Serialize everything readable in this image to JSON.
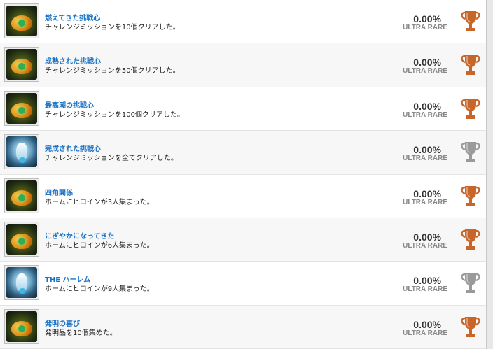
{
  "trophies": [
    {
      "title": "燃えてきた挑戦心",
      "description": "チャレンジミッションを10個クリアした。",
      "percent": "0.00%",
      "rarity": "ULTRA RARE",
      "tier": "bronze",
      "icon": "gold-emblem-icon"
    },
    {
      "title": "成熟された挑戦心",
      "description": "チャレンジミッションを50個クリアした。",
      "percent": "0.00%",
      "rarity": "ULTRA RARE",
      "tier": "bronze",
      "icon": "gold-emblem-icon"
    },
    {
      "title": "最高潮の挑戦心",
      "description": "チャレンジミッションを100個クリアした。",
      "percent": "0.00%",
      "rarity": "ULTRA RARE",
      "tier": "bronze",
      "icon": "gold-emblem-icon"
    },
    {
      "title": "完成された挑戦心",
      "description": "チャレンジミッションを全てクリアした。",
      "percent": "0.00%",
      "rarity": "ULTRA RARE",
      "tier": "silver",
      "icon": "blue-emblem-icon"
    },
    {
      "title": "四角関係",
      "description": "ホームにヒロインが3人集まった。",
      "percent": "0.00%",
      "rarity": "ULTRA RARE",
      "tier": "bronze",
      "icon": "gold-emblem-icon"
    },
    {
      "title": "にぎやかになってきた",
      "description": "ホームにヒロインが6人集まった。",
      "percent": "0.00%",
      "rarity": "ULTRA RARE",
      "tier": "bronze",
      "icon": "gold-emblem-icon"
    },
    {
      "title": "THE ハーレム",
      "description": "ホームにヒロインが9人集まった。",
      "percent": "0.00%",
      "rarity": "ULTRA RARE",
      "tier": "silver",
      "icon": "blue-emblem-icon"
    },
    {
      "title": "発明の喜び",
      "description": "発明品を10個集めた。",
      "percent": "0.00%",
      "rarity": "ULTRA RARE",
      "tier": "bronze",
      "icon": "gold-emblem-icon"
    }
  ],
  "colors": {
    "bronze": "#c8662a",
    "silver": "#9a9a9a",
    "title": "#1a73c6"
  }
}
